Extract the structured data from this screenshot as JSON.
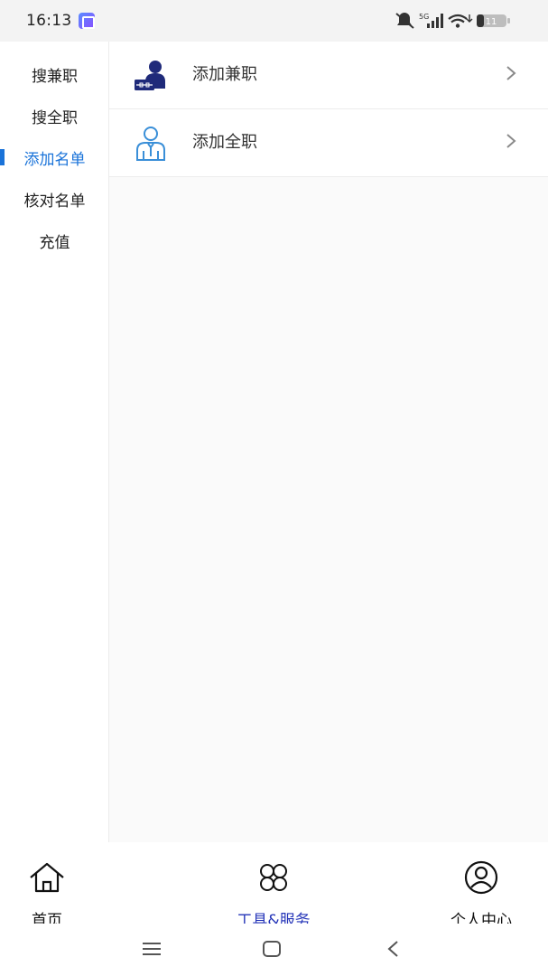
{
  "status_bar": {
    "time": "16:13",
    "network": "5G",
    "battery": "11"
  },
  "sidebar": {
    "items": [
      {
        "label": "搜兼职",
        "active": false
      },
      {
        "label": "搜全职",
        "active": false
      },
      {
        "label": "添加名单",
        "active": true
      },
      {
        "label": "核对名单",
        "active": false
      },
      {
        "label": "充值",
        "active": false
      }
    ]
  },
  "content": {
    "rows": [
      {
        "label": "添加兼职",
        "icon": "part-time-worker-icon"
      },
      {
        "label": "添加全职",
        "icon": "full-time-worker-icon"
      }
    ]
  },
  "tabbar": {
    "tabs": [
      {
        "label": "首页",
        "icon": "home-icon",
        "active": false
      },
      {
        "label": "工具&服务",
        "icon": "grid-icon",
        "active": true
      },
      {
        "label": "个人中心",
        "icon": "user-circle-icon",
        "active": false
      }
    ]
  },
  "colors": {
    "accent": "#1a73d9",
    "tab_active": "#2434b8",
    "icon_navy": "#1f2a7a",
    "icon_blue": "#3a8fd8"
  }
}
